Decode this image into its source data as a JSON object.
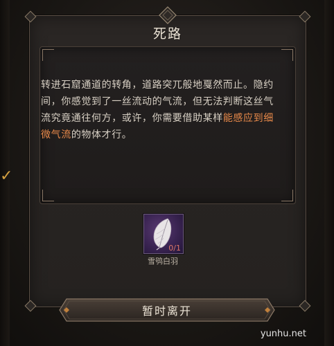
{
  "dialog": {
    "title": "死路",
    "story_before": "转进石窟通道的转角，道路突兀般地戛然而止。隐约间，你感觉到了一丝流动的气流，但无法判断这丝气流究竟通往何方，或许，你需要借助某样",
    "story_highlight": "能感应到细微气流",
    "story_after": "的物体才行。",
    "highlight_color": "#e8894a"
  },
  "required_item": {
    "name": "雪鸮白羽",
    "count": "0/1",
    "icon": "white-feather-icon",
    "rarity_color": "#5a3a72"
  },
  "actions": {
    "leave_label": "暂时离开"
  },
  "watermark": {
    "text": "yunhu.net"
  }
}
